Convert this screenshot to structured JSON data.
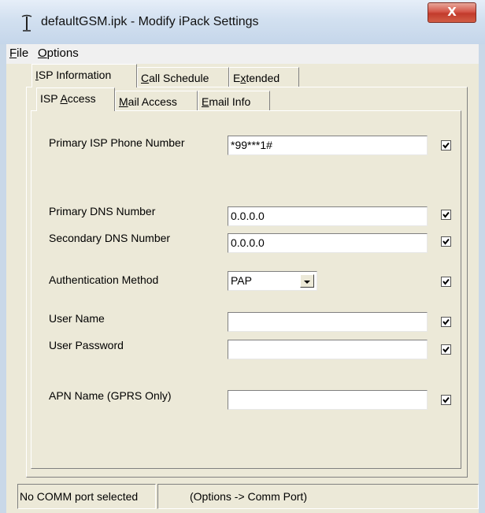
{
  "window": {
    "title": "defaultGSM.ipk - Modify iPack Settings",
    "close_label": "X"
  },
  "menu": {
    "file": {
      "hotkey": "F",
      "rest": "ile"
    },
    "options": {
      "hotkey": "O",
      "rest": "ptions"
    }
  },
  "tabs": [
    {
      "pre": "",
      "hotkey": "I",
      "rest": "SP Information"
    },
    {
      "pre": "",
      "hotkey": "C",
      "rest": "all Schedule"
    },
    {
      "pre": "E",
      "hotkey": "x",
      "rest": "tended"
    }
  ],
  "subtabs": [
    {
      "pre": "ISP ",
      "hotkey": "A",
      "rest": "ccess"
    },
    {
      "pre": "",
      "hotkey": "M",
      "rest": "ail Access"
    },
    {
      "pre": "",
      "hotkey": "E",
      "rest": "mail Info"
    }
  ],
  "fields": {
    "primary_isp_phone": {
      "label": "Primary ISP Phone Number",
      "value": "*99***1#",
      "checked": true
    },
    "primary_dns": {
      "label": "Primary DNS Number",
      "value": "0.0.0.0",
      "checked": true
    },
    "secondary_dns": {
      "label": "Secondary DNS Number",
      "value": "0.0.0.0",
      "checked": true
    },
    "auth_method": {
      "label": "Authentication Method",
      "value": "PAP",
      "checked": true
    },
    "user_name": {
      "label": "User Name",
      "value": "",
      "checked": true
    },
    "user_password": {
      "label": "User Password",
      "value": "",
      "checked": true
    },
    "apn_name": {
      "label": "APN Name (GPRS Only)",
      "value": "",
      "checked": true
    }
  },
  "status": {
    "port": "No COMM port selected",
    "hint": "(Options -> Comm Port)"
  }
}
